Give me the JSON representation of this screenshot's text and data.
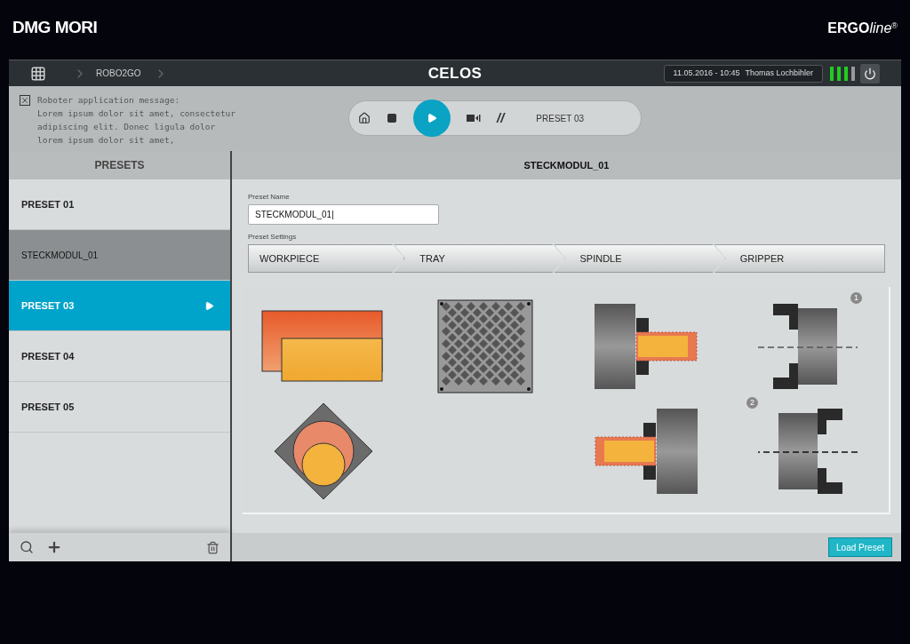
{
  "brand": {
    "left_logo": "DMG MORI",
    "right_logo_bold": "ERGO",
    "right_logo_italic": "line",
    "right_logo_mark": "®"
  },
  "title_bar": {
    "breadcrumb": "ROBO2GO",
    "title": "CELOS",
    "datetime": "11.05.2016 - 10:45",
    "user": "Thomas Lochbihler"
  },
  "message": {
    "lines": [
      "Roboter application message:",
      "Lorem ipsum dolor sit amet, consectetur",
      "adipiscing elit. Donec ligula dolor",
      "lorem ipsum dolor sit amet,"
    ]
  },
  "controls": {
    "playing": true,
    "skip_label": "//",
    "program": "PRESET 03"
  },
  "sidebar": {
    "title": "PRESETS",
    "items": [
      {
        "label": "PRESET 01",
        "selected": false,
        "editing": false
      },
      {
        "label": "STECKMODUL_01",
        "selected": false,
        "editing": true
      },
      {
        "label": "PRESET 03",
        "selected": true,
        "editing": false
      },
      {
        "label": "PRESET 04",
        "selected": false,
        "editing": false
      },
      {
        "label": "PRESET 05",
        "selected": false,
        "editing": false
      }
    ]
  },
  "detail": {
    "title": "STECKMODUL_01",
    "name_label": "Preset Name",
    "name_value": "STECKMODUL_01|",
    "settings_label": "Preset Settings",
    "steps": [
      "WORKPIECE",
      "TRAY",
      "SPINDLE",
      "GRIPPER"
    ],
    "tiles": [
      {
        "kind": "block"
      },
      {
        "kind": "tray"
      },
      {
        "kind": "spindle_left"
      },
      {
        "kind": "gripper_open",
        "badge": "1"
      },
      {
        "kind": "round"
      },
      {
        "kind": "blank"
      },
      {
        "kind": "spindle_right"
      },
      {
        "kind": "gripper_closed",
        "badge": "2"
      }
    ],
    "load_button": "Load Preset"
  }
}
